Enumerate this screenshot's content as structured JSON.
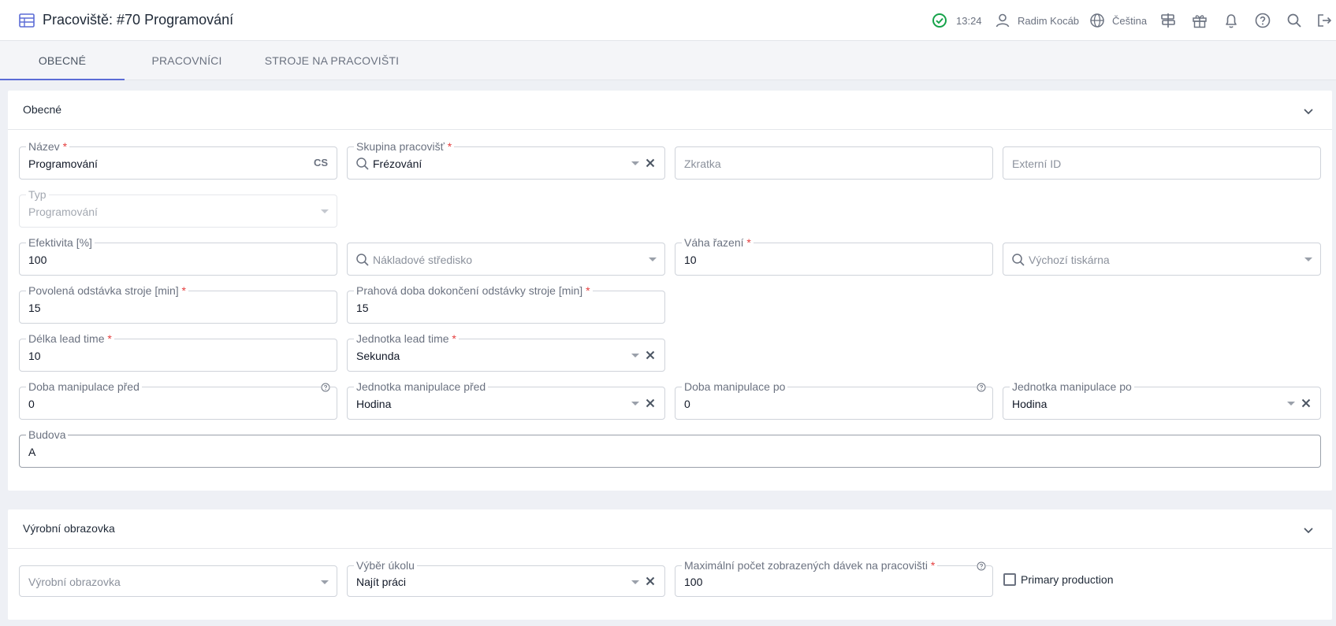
{
  "header": {
    "title": "Pracoviště: #70 Programování",
    "time": "13:24",
    "user": "Radim Kocáb",
    "language": "Čeština",
    "icons": [
      "table-icon",
      "check-circle-icon",
      "user-icon",
      "globe-icon",
      "signpost-icon",
      "gift-icon",
      "bell-icon",
      "help-icon",
      "search-icon",
      "logout-icon"
    ]
  },
  "tabs": [
    {
      "label": "OBECNÉ",
      "active": true
    },
    {
      "label": "PRACOVNÍCI",
      "active": false
    },
    {
      "label": "STROJE NA PRACOVIŠTI",
      "active": false
    }
  ],
  "general": {
    "title": "Obecné",
    "nazev": {
      "label": "Název",
      "value": "Programování",
      "lang": "CS"
    },
    "skupina": {
      "label": "Skupina pracovišť",
      "value": "Frézování"
    },
    "zkratka": {
      "placeholder": "Zkratka"
    },
    "externi": {
      "placeholder": "Externí ID"
    },
    "typ": {
      "label": "Typ",
      "value": "Programování"
    },
    "efektivita": {
      "label": "Efektivita [%]",
      "value": "100"
    },
    "nakladove": {
      "placeholder": "Nákladové středisko"
    },
    "vaha": {
      "label": "Váha řazení",
      "value": "10"
    },
    "tiskarna": {
      "placeholder": "Výchozí tiskárna"
    },
    "odstavka": {
      "label": "Povolená odstávka stroje [min]",
      "value": "15"
    },
    "prahova": {
      "label": "Prahová doba dokončení odstávky stroje [min]",
      "value": "15"
    },
    "delka": {
      "label": "Délka lead time",
      "value": "10"
    },
    "jednotka_lead": {
      "label": "Jednotka lead time",
      "value": "Sekunda"
    },
    "manip_pred": {
      "label": "Doba manipulace před",
      "value": "0"
    },
    "jedn_manip_pred": {
      "label": "Jednotka manipulace před",
      "value": "Hodina"
    },
    "manip_po": {
      "label": "Doba manipulace po",
      "value": "0"
    },
    "jedn_manip_po": {
      "label": "Jednotka manipulace po",
      "value": "Hodina"
    },
    "budova": {
      "label": "Budova",
      "value": "A"
    }
  },
  "production": {
    "title": "Výrobní obrazovka",
    "obrazovka": {
      "placeholder": "Výrobní obrazovka"
    },
    "vyber": {
      "label": "Výběr úkolu",
      "value": "Najít práci"
    },
    "max_davek": {
      "label": "Maximální počet zobrazených dávek na pracovišti",
      "value": "100"
    },
    "primary": {
      "label": "Primary production",
      "checked": false
    }
  }
}
